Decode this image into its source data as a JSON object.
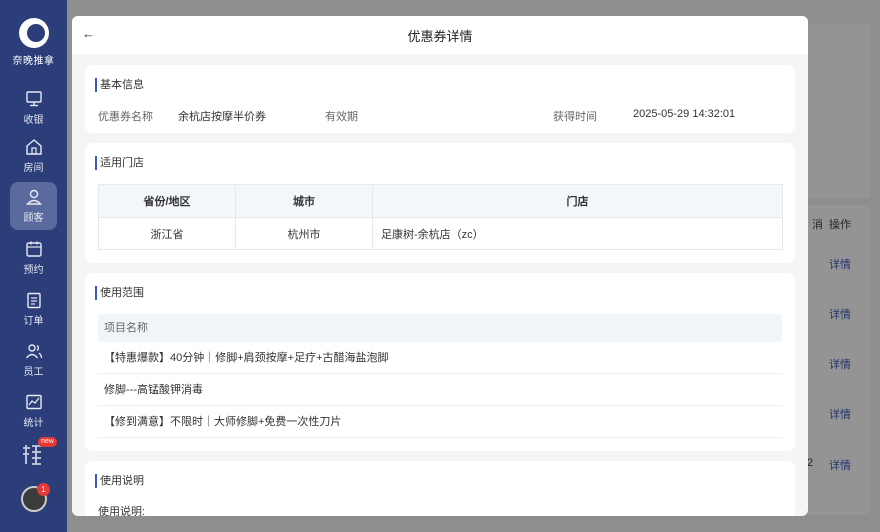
{
  "sidebar": {
    "logo_text": "奈晚推拿",
    "items": [
      {
        "label": "收银",
        "icon": "monitor-icon"
      },
      {
        "label": "房间",
        "icon": "home-icon"
      },
      {
        "label": "顾客",
        "icon": "user-icon"
      },
      {
        "label": "预约",
        "icon": "calendar-icon"
      },
      {
        "label": "订单",
        "icon": "clipboard-icon"
      },
      {
        "label": "员工",
        "icon": "staff-icon"
      },
      {
        "label": "统计",
        "icon": "chart-icon"
      }
    ],
    "extra_badge": "new",
    "notification_count": "1"
  },
  "background": {
    "column_headers": [
      "消",
      "操作"
    ],
    "row_action": "详情",
    "partial_digit": "2"
  },
  "dialog": {
    "title": "优惠券详情",
    "basic": {
      "title": "基本信息",
      "name_label": "优惠券名称",
      "name_value": "余杭店按摩半价券",
      "valid_label": "有效期",
      "obtained_label": "获得时间",
      "obtained_value": "2025-05-29 14:32:01"
    },
    "stores": {
      "title": "适用门店",
      "headers": [
        "省份/地区",
        "城市",
        "门店"
      ],
      "rows": [
        [
          "浙江省",
          "杭州市",
          "足康树-余杭店（zc）"
        ]
      ]
    },
    "scope": {
      "title": "使用范围",
      "header": "项目名称",
      "items": [
        "【特惠爆款】40分钟｜修脚+肩颈按摩+足疗+古醋海盐泡脚",
        "修脚---高锰酸钾消毒",
        "【修到满意】不限时｜大师修脚+免费一次性刀片"
      ]
    },
    "instructions": {
      "title": "使用说明",
      "text": "使用说明:"
    }
  }
}
